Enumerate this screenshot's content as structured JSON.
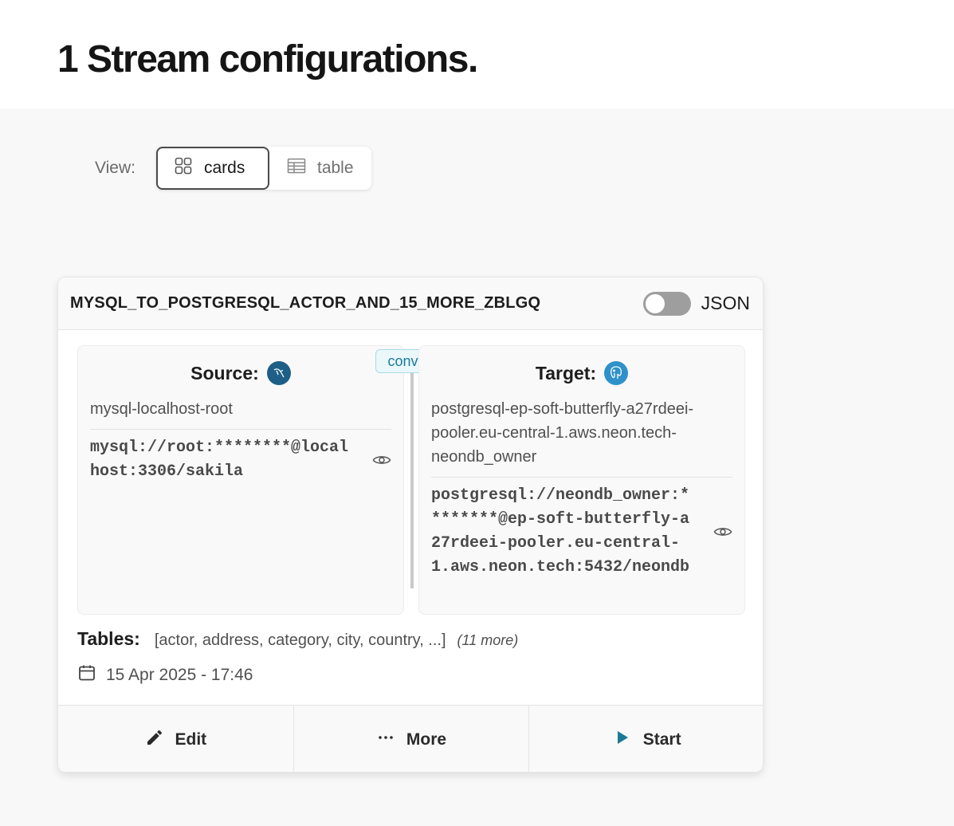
{
  "page": {
    "title": "1 Stream configurations."
  },
  "view": {
    "label": "View:",
    "options": [
      {
        "label": "cards",
        "icon": "grid-icon",
        "active": true
      },
      {
        "label": "table",
        "icon": "table-icon",
        "active": false
      }
    ]
  },
  "stream": {
    "name": "MYSQL_TO_POSTGRESQL_ACTOR_AND_15_MORE_ZBLGQ",
    "json_label": "JSON",
    "json_enabled": false,
    "convert_label": "convert",
    "source": {
      "heading": "Source:",
      "icon": "mysql-icon",
      "connection_name": "mysql-localhost-root",
      "connection_url": "mysql://root:********@localhost:3306/sakila"
    },
    "target": {
      "heading": "Target:",
      "icon": "postgresql-icon",
      "connection_name": "postgresql-ep-soft-butterfly-a27rdeei-pooler.eu-central-1.aws.neon.tech-neondb_owner",
      "connection_url": "postgresql://neondb_owner:********@ep-soft-butterfly-a27rdeei-pooler.eu-central-1.aws.neon.tech:5432/neondb"
    },
    "tables_label": "Tables:",
    "tables_value": "[actor, address, category, city, country, ...]",
    "tables_more": "(11 more)",
    "created": "15 Apr 2025 - 17:46"
  },
  "actions": {
    "edit": "Edit",
    "more": "More",
    "start": "Start"
  },
  "colors": {
    "accent": "#1b7a96",
    "mysql": "#1d5f86",
    "postgresql": "#2f91c9"
  }
}
